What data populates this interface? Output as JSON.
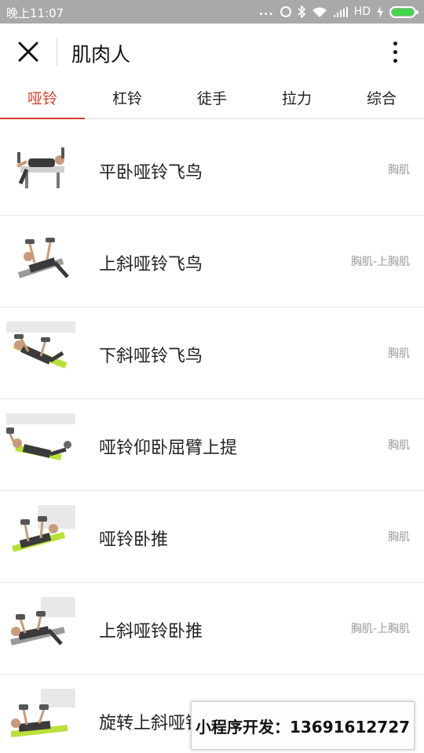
{
  "status_bar": {
    "time": "晚上11:07",
    "dots": "...",
    "network": "HD"
  },
  "navbar": {
    "title": "肌肉人",
    "close_icon": "close-icon",
    "more_icon": "more-vertical-icon"
  },
  "tabs": [
    {
      "label": "哑铃",
      "active": true
    },
    {
      "label": "杠铃",
      "active": false
    },
    {
      "label": "徒手",
      "active": false
    },
    {
      "label": "拉力",
      "active": false
    },
    {
      "label": "综合",
      "active": false
    }
  ],
  "exercises": [
    {
      "name": "平卧哑铃飞鸟",
      "muscle": "胸肌"
    },
    {
      "name": "上斜哑铃飞鸟",
      "muscle": "胸肌-上胸肌"
    },
    {
      "name": "下斜哑铃飞鸟",
      "muscle": "胸肌"
    },
    {
      "name": "哑铃仰卧屈臂上提",
      "muscle": "胸肌"
    },
    {
      "name": "哑铃卧推",
      "muscle": "胸肌"
    },
    {
      "name": "上斜哑铃卧推",
      "muscle": "胸肌-上胸肌"
    },
    {
      "name": "旋转上斜哑铃",
      "muscle": ""
    }
  ],
  "promo": {
    "text": "小程序开发：13691612727"
  },
  "colors": {
    "accent": "#d3412a",
    "status_bar_bg": "#a9a9a9",
    "battery_green": "#42d64a",
    "bench_green": "#b8e03a"
  }
}
